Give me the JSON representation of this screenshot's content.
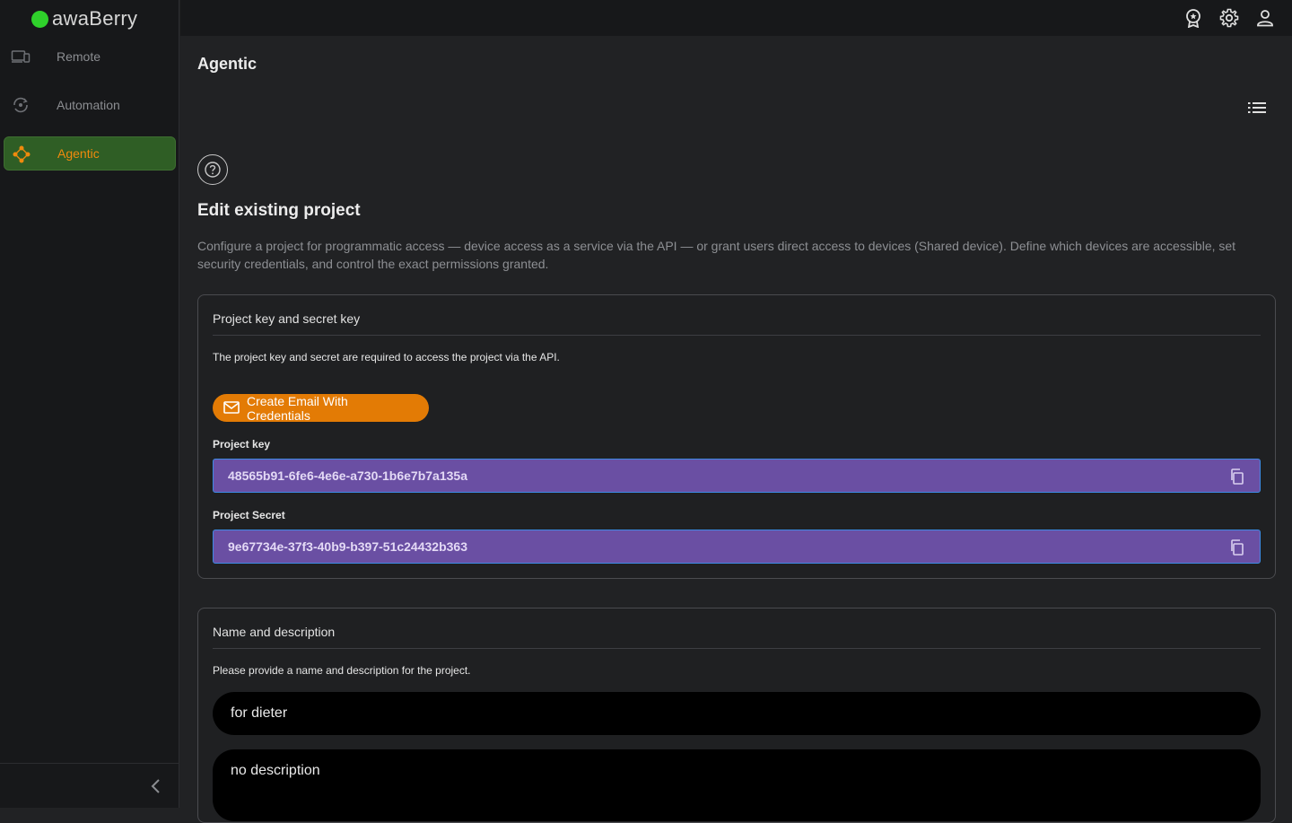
{
  "app": {
    "brand": "awaBerry"
  },
  "sidebar": {
    "items": [
      {
        "label": "Remote",
        "icon": "devices-icon",
        "active": false
      },
      {
        "label": "Automation",
        "icon": "automation-icon",
        "active": false
      },
      {
        "label": "Agentic",
        "icon": "agentic-icon",
        "active": true
      }
    ],
    "collapse_icon": "chevron-left-icon"
  },
  "topbar": {
    "icons": [
      "award-icon",
      "gear-icon",
      "user-icon"
    ]
  },
  "page": {
    "title": "Agentic",
    "section_title": "Edit existing project",
    "section_desc": "Configure a project for programmatic access — device access as a service via the API — or grant users direct access to devices (Shared device). Define which devices are accessible, set security credentials, and control the exact permissions granted."
  },
  "keys_card": {
    "title": "Project key and secret key",
    "description": "The project key and secret are required to access the project via the API.",
    "email_button": "Create Email With Credentials",
    "project_key_label": "Project key",
    "project_key_value": "48565b91-6fe6-4e6e-a730-1b6e7b7a135a",
    "project_secret_label": "Project Secret",
    "project_secret_value": "9e67734e-37f3-40b9-b397-51c24432b363"
  },
  "name_card": {
    "title": "Name and description",
    "description": "Please provide a name and description for the project.",
    "name_value": "for dieter",
    "description_value": "no description"
  },
  "colors": {
    "accent_orange": "#e37b05",
    "active_nav_bg": "#2f5e25",
    "key_field_bg": "#6a4fa3",
    "brand_dot": "#2fd12b"
  }
}
